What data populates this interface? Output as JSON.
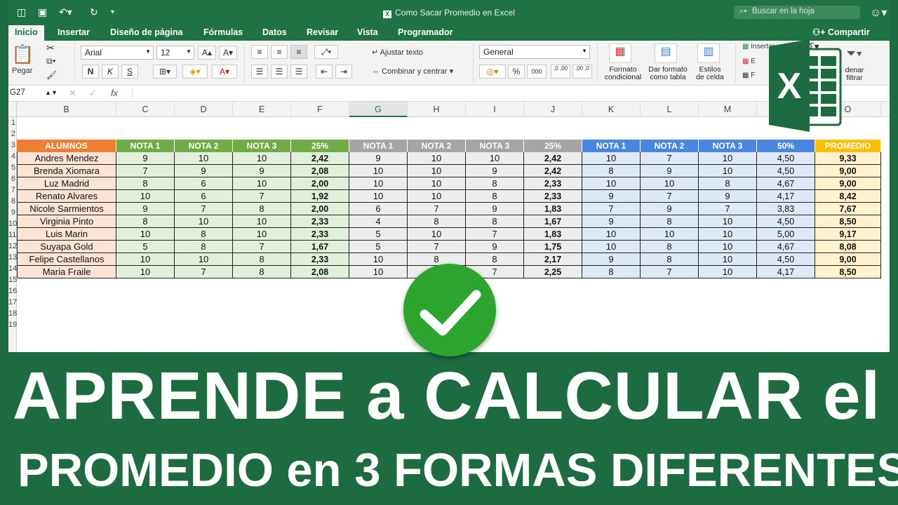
{
  "window": {
    "title": "Como Sacar Promedio en Excel",
    "search_placeholder": "Buscar en la hoja"
  },
  "tabs": [
    "Inicio",
    "Insertar",
    "Diseño de página",
    "Fórmulas",
    "Datos",
    "Revisar",
    "Vista",
    "Programador"
  ],
  "share_label": "Compartir",
  "ribbon": {
    "paste_label": "Pegar",
    "font_name": "Arial",
    "font_size": "12",
    "bold": "N",
    "italic": "K",
    "underline": "S",
    "wrap_text": "Ajustar texto",
    "merge_center": "Combinar y centrar",
    "number_format": "General",
    "percent": "%",
    "thousands": "000",
    "dec_inc": ",0 ,00",
    "dec_dec": ",00 ,0",
    "conditional_format_l1": "Formato",
    "conditional_format_l2": "condicional",
    "format_table_l1": "Dar formato",
    "format_table_l2": "como tabla",
    "cell_styles_l1": "Estilos",
    "cell_styles_l2": "de celda",
    "insert_partial": "Insertar",
    "e_partial": "E",
    "f_partial": "F",
    "sort_l1": "denar",
    "sort_l2": "filtrar"
  },
  "formula_bar": {
    "name_box": "G27",
    "fx": "fx"
  },
  "columns": [
    "B",
    "C",
    "D",
    "E",
    "F",
    "G",
    "H",
    "I",
    "J",
    "K",
    "L",
    "M",
    "N",
    "O"
  ],
  "selected_column": "G",
  "row_numbers": [
    "1",
    "2",
    "3",
    "4",
    "5",
    "6",
    "7",
    "8",
    "9",
    "10",
    "11",
    "12",
    "13",
    "14",
    "15",
    "16",
    "17",
    "18",
    "19"
  ],
  "colors": {
    "excel_green": "#1f7244",
    "header_orange": "#ef7d32",
    "header_green": "#6fac46",
    "header_gray": "#a5a5a5",
    "header_blue": "#4a86e0",
    "header_gold": "#fdbf00",
    "fill_orange": "#fbe3d5",
    "fill_green": "#e2efda",
    "fill_gray": "#ededed",
    "fill_blue": "#dde9f6",
    "fill_gold": "#fff2cc"
  },
  "table": {
    "headers": [
      "ALUMNOS",
      "NOTA 1",
      "NOTA 2",
      "NOTA 3",
      "25%",
      "NOTA 1",
      "NOTA 2",
      "NOTA 3",
      "25%",
      "NOTA 1",
      "NOTA 2",
      "NOTA 3",
      "50%",
      "PROMEDIO"
    ],
    "rows": [
      [
        "Andres Mendez",
        "9",
        "10",
        "10",
        "2,42",
        "9",
        "10",
        "10",
        "2,42",
        "10",
        "7",
        "10",
        "4,50",
        "9,33"
      ],
      [
        "Brenda Xiomara",
        "7",
        "9",
        "9",
        "2,08",
        "10",
        "10",
        "9",
        "2,42",
        "8",
        "9",
        "10",
        "4,50",
        "9,00"
      ],
      [
        "Luz Madrid",
        "8",
        "6",
        "10",
        "2,00",
        "10",
        "10",
        "8",
        "2,33",
        "10",
        "10",
        "8",
        "4,67",
        "9,00"
      ],
      [
        "Renato Alvares",
        "10",
        "6",
        "7",
        "1,92",
        "10",
        "10",
        "8",
        "2,33",
        "9",
        "7",
        "9",
        "4,17",
        "8,42"
      ],
      [
        "Nicole Sarmientos",
        "9",
        "7",
        "8",
        "2,00",
        "6",
        "7",
        "9",
        "1,83",
        "7",
        "9",
        "7",
        "3,83",
        "7,67"
      ],
      [
        "Virginia Pinto",
        "8",
        "10",
        "10",
        "2,33",
        "4",
        "8",
        "8",
        "1,67",
        "9",
        "8",
        "10",
        "4,50",
        "8,50"
      ],
      [
        "Luis Marin",
        "10",
        "8",
        "10",
        "2,33",
        "5",
        "10",
        "7",
        "1,83",
        "10",
        "10",
        "10",
        "5,00",
        "9,17"
      ],
      [
        "Suyapa Gold",
        "5",
        "8",
        "7",
        "1,67",
        "5",
        "7",
        "9",
        "1,75",
        "10",
        "8",
        "10",
        "4,67",
        "8,08"
      ],
      [
        "Felipe Castellanos",
        "10",
        "10",
        "8",
        "2,33",
        "10",
        "8",
        "8",
        "2,17",
        "9",
        "8",
        "10",
        "4,50",
        "9,00"
      ],
      [
        "Maria Fraile",
        "10",
        "7",
        "8",
        "2,08",
        "10",
        "8",
        "7",
        "2,25",
        "8",
        "7",
        "10",
        "4,17",
        "8,50"
      ]
    ]
  },
  "banner": {
    "line1": "APRENDE a CALCULAR el",
    "line2": "PROMEDIO en 3 FORMAS DIFERENTES"
  },
  "logo_letter": "X"
}
